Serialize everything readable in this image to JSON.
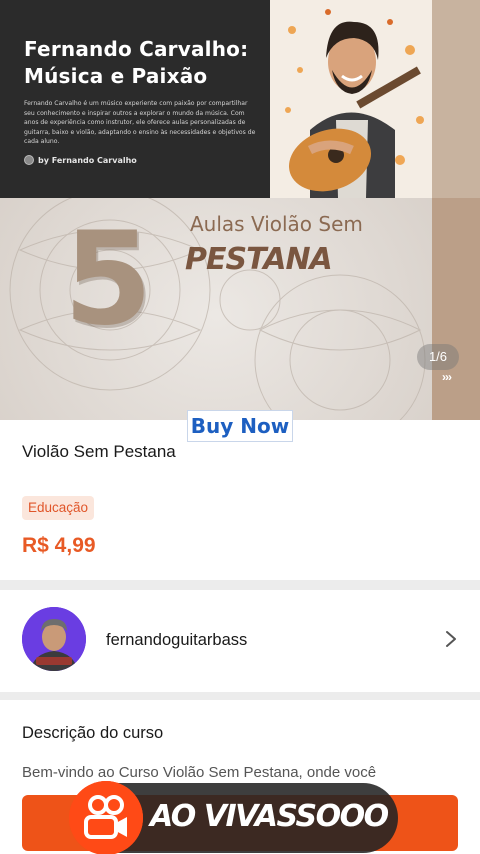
{
  "banner": {
    "author_title": "Fernando Carvalho: Música e Paixão",
    "author_description": "Fernando Carvalho é um músico experiente com paixão por compartilhar seu conhecimento e inspirar outros a explorar o mundo da música. Com anos de experiência como instrutor, ele oferece aulas personalizadas de guitarra, baixo e violão, adaptando o ensino às necessidades e objetivos de cada aluno.",
    "author_by": "by Fernando Carvalho",
    "big_number": "5",
    "lesson_title": "Aulas Violão Sem",
    "lesson_subtitle": "PESTANA",
    "slide_counter": "1/6",
    "next_icon": "triple-chevron-right-icon",
    "accent_color": "#a8927e"
  },
  "buy_now_label": "Buy Now",
  "product": {
    "title": "Violão Sem Pestana",
    "category": "Educação",
    "price": "R$ 4,99",
    "price_color": "#e85a25"
  },
  "seller": {
    "name": "fernandoguitarbass",
    "chevron_icon": "chevron-right-icon"
  },
  "description": {
    "heading": "Descrição do curso",
    "text": "Bem-vindo ao Curso Violão Sem Pestana, onde você"
  },
  "live_overlay": {
    "label": "AO VIVASSOOO",
    "logo_icon": "kwai-camera-icon",
    "brand_color": "#ff4a16"
  }
}
